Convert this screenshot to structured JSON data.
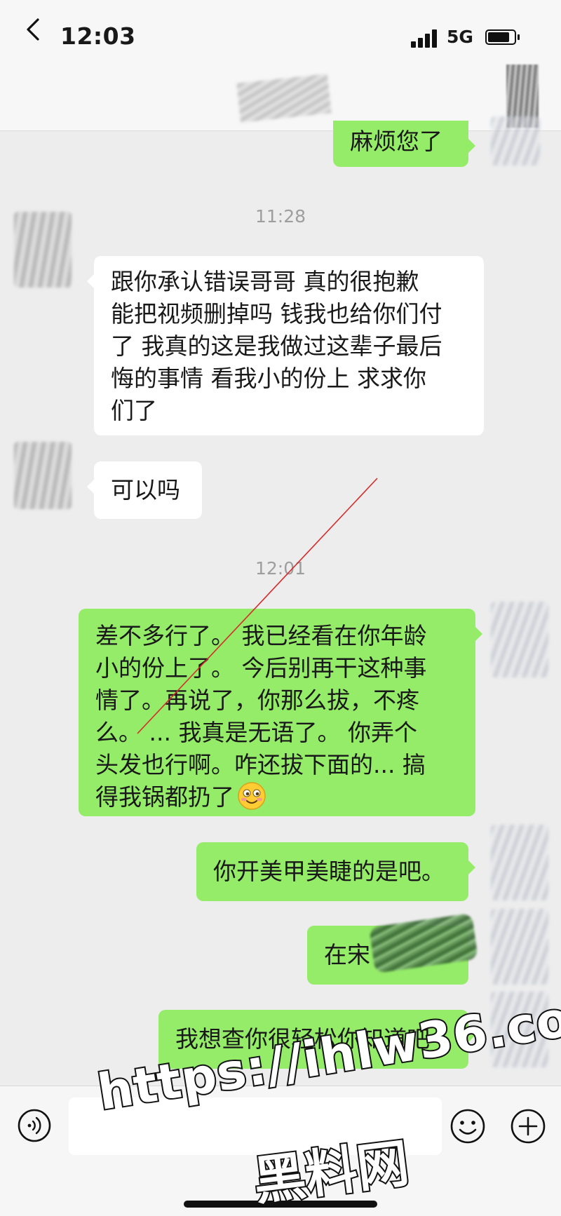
{
  "status_bar": {
    "time": "12:03",
    "network": "5G",
    "battery_level": 0.85
  },
  "nav": {
    "back_label": "<"
  },
  "messages": {
    "partial_top": {
      "text": "麻烦您了"
    },
    "timestamp_1": "11:28",
    "in_1": {
      "lines": [
        "跟你承认错误哥哥 真的很抱歉",
        "能把视频删掉吗 钱我也给你们付",
        "了 我真的这是我做过这辈子最后",
        "悔的事情 看我小的份上 求求你",
        "们了"
      ]
    },
    "in_2": {
      "text": "可以吗"
    },
    "timestamp_2": "12:01",
    "out_1": {
      "lines": [
        "差不多行了。 我已经看在你年龄",
        "小的份上了。 今后别再干这种事",
        "情了。再说了，你那么拔，不疼",
        "么。 ... 我真是无语了。 你弄个",
        "头发也行啊。咋还拔下面的... 搞",
        "得我锅都扔了"
      ]
    },
    "out_2": {
      "text": "你开美甲美睫的是吧。"
    },
    "out_3": {
      "text": "在宋"
    },
    "out_4": {
      "text": "我想查你很轻松你知道吧"
    }
  },
  "input_bar": {
    "placeholder": ""
  },
  "icons": {
    "back": "chevron-left-icon",
    "voice": "voice-icon",
    "emoji": "smiley-icon",
    "plus": "plus-icon",
    "reaction": "smiley-emoji"
  },
  "colors": {
    "outgoing": "#95ec69",
    "incoming": "#ffffff",
    "background": "#ededed",
    "annotation": "#d42b2b"
  },
  "watermark": {
    "url": "https://ihlw36.com",
    "name": "黑料网"
  }
}
